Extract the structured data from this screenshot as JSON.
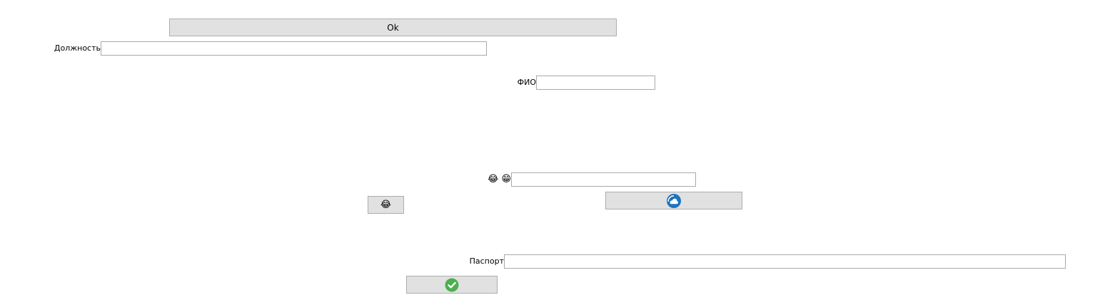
{
  "buttons": {
    "ok_label": "Ok",
    "laugh_button_icon": "😂",
    "cloud_button_icon": "cloud-icon",
    "check_button_icon": "check-icon"
  },
  "fields": {
    "position_label": "Должность",
    "position_value": "",
    "fio_label": "ФИО",
    "fio_value": "",
    "emoji_label": "😂 😁",
    "emoji_value": "",
    "passport_label": "Паспорт",
    "passport_value": ""
  },
  "colors": {
    "button_bg": "#e1e1e1",
    "button_border": "#adadad",
    "field_border": "#a9a9a9",
    "cloud_blue": "#1e73be",
    "check_green": "#4caf50"
  }
}
